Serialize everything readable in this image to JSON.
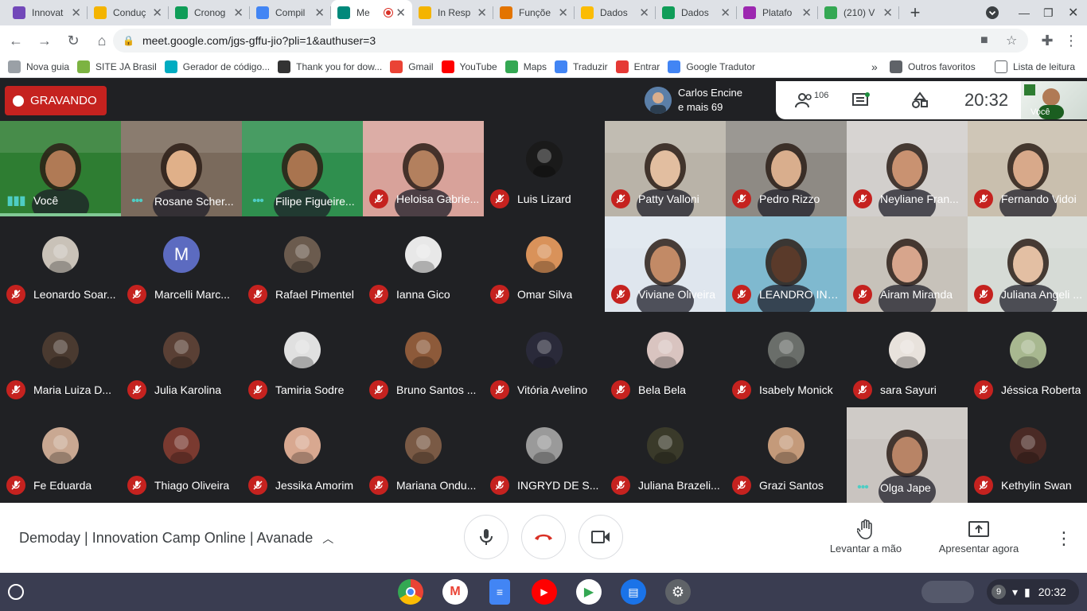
{
  "browser": {
    "tabs": [
      {
        "label": "Innovat",
        "color": "#7248b9"
      },
      {
        "label": "Conduç",
        "color": "#f4b400"
      },
      {
        "label": "Cronog",
        "color": "#0f9d58"
      },
      {
        "label": "Compil",
        "color": "#4285f4"
      },
      {
        "label": "Me",
        "color": "#00897b",
        "active": true
      },
      {
        "label": "In Resp",
        "color": "#f4b400"
      },
      {
        "label": "Funçõe",
        "color": "#e37400"
      },
      {
        "label": "Dados",
        "color": "#fbbc04"
      },
      {
        "label": "Dados",
        "color": "#0f9d58"
      },
      {
        "label": "Platafo",
        "color": "#9c27b0"
      },
      {
        "label": "(210) V",
        "color": "#34a853"
      }
    ],
    "url": "meet.google.com/jgs-gffu-jio?pli=1&authuser=3",
    "bookmarks": [
      {
        "label": "Nova guia",
        "color": "#9aa0a6"
      },
      {
        "label": "SITE JA Brasil",
        "color": "#7cb342"
      },
      {
        "label": "Gerador de código...",
        "color": "#00acc1"
      },
      {
        "label": "Thank you for dow...",
        "color": "#333333"
      },
      {
        "label": "Gmail",
        "color": "#ea4335"
      },
      {
        "label": "YouTube",
        "color": "#ff0000"
      },
      {
        "label": "Maps",
        "color": "#34a853"
      },
      {
        "label": "Traduzir",
        "color": "#4285f4"
      },
      {
        "label": "Entrar",
        "color": "#e53935"
      },
      {
        "label": "Google Tradutor",
        "color": "#4285f4"
      }
    ],
    "other_bookmarks": "Outros favoritos",
    "reading_list": "Lista de leitura"
  },
  "meet": {
    "recording_label": "GRAVANDO",
    "presenter_line1": "Carlos Encine",
    "presenter_line2": "e mais 69",
    "participant_count": "106",
    "time": "20:32",
    "self_label": "Você",
    "meeting_name": "Demoday | Innovation Camp Online | Avanade",
    "raise_hand": "Levantar a mão",
    "present_now": "Apresentar agora",
    "participants": [
      {
        "name": "Você",
        "type": "video",
        "bg": "#2e7d32",
        "skin": "#b07a55",
        "status": "speaking",
        "self": true
      },
      {
        "name": "Rosane Scher...",
        "type": "video",
        "bg": "#7a6a5c",
        "skin": "#e0b089",
        "status": "speaking"
      },
      {
        "name": "Filipe Figueire...",
        "type": "video",
        "bg": "#2f8f4e",
        "skin": "#a9744f",
        "status": "speaking"
      },
      {
        "name": "Heloisa Gabrie...",
        "type": "video",
        "bg": "#d8a29a",
        "skin": "#b3805e",
        "status": "muted"
      },
      {
        "name": "Luis Lizard",
        "type": "avatar",
        "avatar_color": "#1a1a1a",
        "status": "muted"
      },
      {
        "name": "Patty Valloni",
        "type": "video",
        "bg": "#b9b3a8",
        "skin": "#e2bea0",
        "status": "muted"
      },
      {
        "name": "Pedro Rizzo",
        "type": "video",
        "bg": "#8e8a84",
        "skin": "#d9ae8d",
        "status": "muted"
      },
      {
        "name": "Neyliane Fran...",
        "type": "video",
        "bg": "#d2cfcc",
        "skin": "#c99271",
        "status": "muted"
      },
      {
        "name": "Fernando Vidoi",
        "type": "video",
        "bg": "#c9bfae",
        "skin": "#d8a98a",
        "status": "muted"
      },
      {
        "name": "Leonardo Soar...",
        "type": "avatar",
        "avatar_color": "#c9c2b8",
        "status": "muted"
      },
      {
        "name": "Marcelli Marc...",
        "type": "avatar",
        "avatar_color": "#5c6bc0",
        "initial": "M",
        "status": "muted"
      },
      {
        "name": "Rafael Pimentel",
        "type": "avatar",
        "avatar_color": "#6b5b4e",
        "status": "muted"
      },
      {
        "name": "Ianna Gico",
        "type": "avatar",
        "avatar_color": "#e8e8e8",
        "status": "muted"
      },
      {
        "name": "Omar Silva",
        "type": "avatar",
        "avatar_color": "#d9925a",
        "status": "muted"
      },
      {
        "name": "Viviane Oliveira",
        "type": "video",
        "bg": "#dfe6ee",
        "skin": "#c28a66",
        "status": "muted"
      },
      {
        "name": "LEANDRO INA...",
        "type": "video",
        "bg": "#7fb9cf",
        "skin": "#5a3a2a",
        "status": "muted"
      },
      {
        "name": "Airam Miranda",
        "type": "video",
        "bg": "#c7c2ba",
        "skin": "#d7a58c",
        "status": "muted"
      },
      {
        "name": "Juliana Angeli ...",
        "type": "video",
        "bg": "#d6dbd6",
        "skin": "#e3bfa3",
        "status": "muted"
      },
      {
        "name": "Maria Luiza D...",
        "type": "avatar",
        "avatar_color": "#4a3a30",
        "status": "muted"
      },
      {
        "name": "Julia Karolina",
        "type": "avatar",
        "avatar_color": "#5a4035",
        "status": "muted"
      },
      {
        "name": "Tamiria Sodre",
        "type": "avatar",
        "avatar_color": "#e0e0e0",
        "status": "muted"
      },
      {
        "name": "Bruno Santos ...",
        "type": "avatar",
        "avatar_color": "#8d5a3a",
        "status": "muted"
      },
      {
        "name": "Vitória Avelino",
        "type": "avatar",
        "avatar_color": "#2a2a3a",
        "status": "muted"
      },
      {
        "name": "Bela Bela",
        "type": "avatar",
        "avatar_color": "#d9c4c0",
        "status": "muted"
      },
      {
        "name": "Isabely Monick",
        "type": "avatar",
        "avatar_color": "#6a6e6a",
        "status": "muted"
      },
      {
        "name": "sara Sayuri",
        "type": "avatar",
        "avatar_color": "#e8e2dc",
        "status": "muted"
      },
      {
        "name": "Jéssica Roberta",
        "type": "avatar",
        "avatar_color": "#a8b890",
        "status": "muted"
      },
      {
        "name": "Fe Eduarda",
        "type": "avatar",
        "avatar_color": "#c9a892",
        "status": "muted"
      },
      {
        "name": "Thiago Oliveira",
        "type": "avatar",
        "avatar_color": "#7a3a30",
        "status": "muted"
      },
      {
        "name": "Jessika Amorim",
        "type": "avatar",
        "avatar_color": "#d8a890",
        "status": "muted"
      },
      {
        "name": "Mariana Ondu...",
        "type": "avatar",
        "avatar_color": "#7a5a45",
        "status": "muted"
      },
      {
        "name": "INGRYD DE S...",
        "type": "avatar",
        "avatar_color": "#9a9a9a",
        "status": "muted"
      },
      {
        "name": "Juliana Brazeli...",
        "type": "avatar",
        "avatar_color": "#3a3a2a",
        "status": "muted"
      },
      {
        "name": "Grazi Santos",
        "type": "avatar",
        "avatar_color": "#c49a7a",
        "status": "muted"
      },
      {
        "name": "Olga Jape",
        "type": "video",
        "bg": "#c9c4c0",
        "skin": "#b88466",
        "status": "speaking"
      },
      {
        "name": "Kethylin Swan",
        "type": "avatar",
        "avatar_color": "#4a2a25",
        "status": "muted"
      }
    ]
  },
  "system": {
    "time": "20:32",
    "notifications": "9"
  }
}
